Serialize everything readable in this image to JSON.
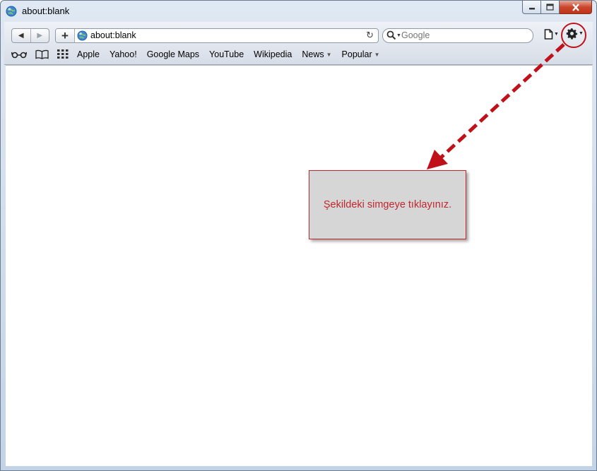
{
  "window": {
    "title": "about:blank"
  },
  "nav": {
    "back_glyph": "◀",
    "forward_glyph": "▶"
  },
  "address": {
    "add_glyph": "+",
    "url": "about:blank",
    "reload_glyph": "↻"
  },
  "search": {
    "placeholder": "Google"
  },
  "bookmarks": {
    "items": [
      {
        "label": "Apple"
      },
      {
        "label": "Yahoo!"
      },
      {
        "label": "Google Maps"
      },
      {
        "label": "YouTube"
      },
      {
        "label": "Wikipedia"
      },
      {
        "label": "News",
        "dropdown": "▼"
      },
      {
        "label": "Popular",
        "dropdown": "▼"
      }
    ]
  },
  "annotation": {
    "text": "Şekildeki simgeye tıklayınız.",
    "color": "#c0282c"
  },
  "icons": {
    "title": "globe-icon",
    "window_controls": [
      "minimize-icon",
      "maximize-icon",
      "close-icon"
    ],
    "toolbar": [
      "page-menu-icon",
      "gear-icon"
    ],
    "bookmarks_bar": [
      "reading-list-icon",
      "bookmarks-book-icon",
      "top-sites-grid-icon"
    ]
  }
}
